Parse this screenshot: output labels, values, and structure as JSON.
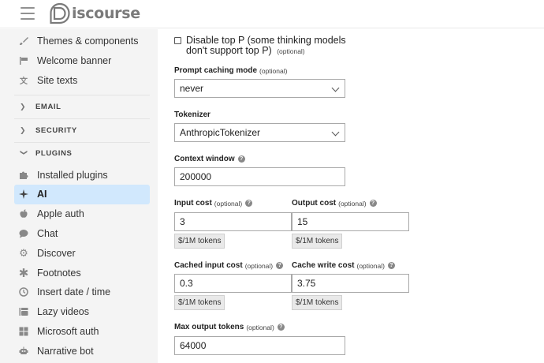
{
  "header": {
    "brand": "iscourse"
  },
  "sidebar": {
    "items_top": [
      {
        "label": "Themes & components",
        "icon": "paintbrush-icon"
      },
      {
        "label": "Welcome banner",
        "icon": "signpost-icon"
      },
      {
        "label": "Site texts",
        "icon": "language-icon"
      }
    ],
    "sections": [
      {
        "label": "EMAIL"
      },
      {
        "label": "SECURITY"
      },
      {
        "label": "PLUGINS"
      }
    ],
    "plugins": [
      {
        "label": "Installed plugins",
        "icon": "puzzle-icon"
      },
      {
        "label": "AI",
        "icon": "sparkle-icon"
      },
      {
        "label": "Apple auth",
        "icon": "apple-icon"
      },
      {
        "label": "Chat",
        "icon": "chat-bubble-icon"
      },
      {
        "label": "Discover",
        "icon": "gear-icon"
      },
      {
        "label": "Footnotes",
        "icon": "asterisk-icon"
      },
      {
        "label": "Insert date / time",
        "icon": "clock-icon"
      },
      {
        "label": "Lazy videos",
        "icon": "video-icon"
      },
      {
        "label": "Microsoft auth",
        "icon": "windows-icon"
      },
      {
        "label": "Narrative bot",
        "icon": "robot-icon"
      }
    ]
  },
  "form": {
    "disable_top_p": {
      "label": "Disable top P (some thinking models don't support top P)",
      "optional": "(optional)"
    },
    "prompt_caching": {
      "label": "Prompt caching mode",
      "optional": "(optional)",
      "value": "never"
    },
    "tokenizer": {
      "label": "Tokenizer",
      "value": "AnthropicTokenizer"
    },
    "context_window": {
      "label": "Context window",
      "value": "200000"
    },
    "input_cost": {
      "label": "Input cost",
      "optional": "(optional)",
      "value": "3",
      "unit": "$/1M tokens"
    },
    "output_cost": {
      "label": "Output cost",
      "optional": "(optional)",
      "value": "15",
      "unit": "$/1M tokens"
    },
    "cached_input_cost": {
      "label": "Cached input cost",
      "optional": "(optional)",
      "value": "0.3",
      "unit": "$/1M tokens"
    },
    "cache_write_cost": {
      "label": "Cache write cost",
      "optional": "(optional)",
      "value": "3.75",
      "unit": "$/1M tokens"
    },
    "max_output_tokens": {
      "label": "Max output tokens",
      "optional": "(optional)",
      "value": "64000"
    },
    "help_glyph": "?"
  },
  "colors": {
    "active_bg": "#d1e8fd",
    "sidebar_bg": "#f4f4f4"
  }
}
